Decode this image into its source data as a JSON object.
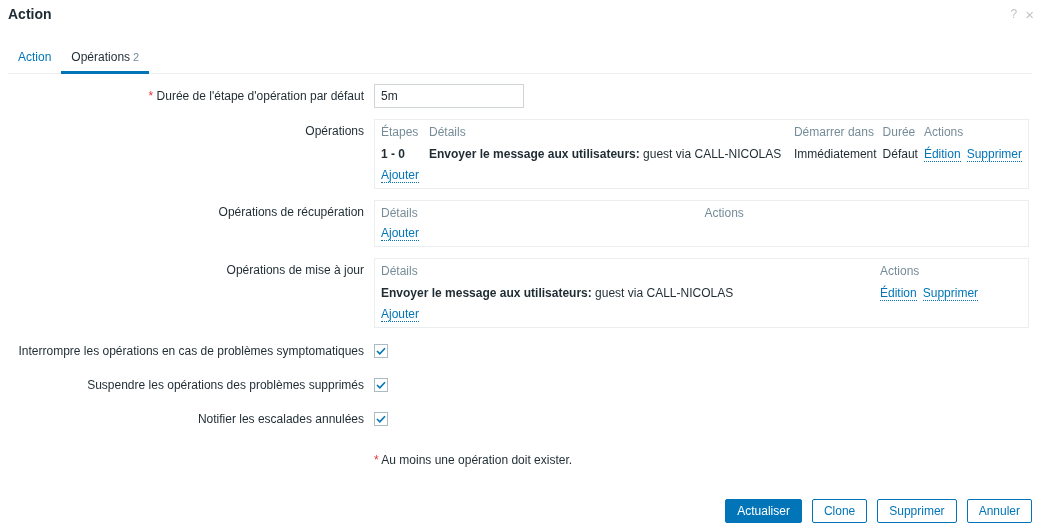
{
  "dialog": {
    "title": "Action",
    "help": "?",
    "close": "×"
  },
  "tabs": [
    {
      "label": "Action",
      "selected": false
    },
    {
      "label": "Opérations",
      "count": "2",
      "selected": true
    }
  ],
  "duration": {
    "label": "Durée de l'étape d'opération par défaut",
    "required": true,
    "value": "5m"
  },
  "tables": [
    {
      "label": "Opérations",
      "columns": [
        "Étapes",
        "Détails",
        "Démarrer dans",
        "Durée",
        "Actions"
      ],
      "rows": [
        {
          "cells": [
            "**1 - 0**",
            "**Envoyer le message aux utilisateurs:** guest via CALL-NICOLAS",
            "Immédiatement",
            "Défaut"
          ],
          "actions": [
            "Édition",
            "Supprimer"
          ]
        }
      ],
      "add_link": "Ajouter"
    },
    {
      "label": "Opérations de récupération",
      "columns": [
        "Détails",
        "Actions"
      ],
      "add_link": "Ajouter"
    },
    {
      "label": "Opérations de mise à jour",
      "columns": [
        "Détails",
        "Actions"
      ],
      "rows": [
        {
          "cells": [
            "**Envoyer le message aux utilisateurs:** guest via CALL-NICOLAS"
          ],
          "actions": [
            "Édition",
            "Supprimer"
          ]
        }
      ],
      "add_link": "Ajouter"
    }
  ],
  "options": [
    {
      "label": "Interrompre les opérations en cas de problèmes symptomatiques",
      "checked": true
    },
    {
      "label": "Suspendre les opérations des problèmes supprimés",
      "checked": true
    },
    {
      "label": "Notifier les escalades annulées",
      "checked": true
    }
  ],
  "note": {
    "mark": "*",
    "text": "Au moins une opération doit exister."
  },
  "buttons": [
    {
      "label": "Actualiser",
      "kind": "primary"
    },
    {
      "label": "Clone",
      "kind": "secondary"
    },
    {
      "label": "Supprimer",
      "kind": "secondary"
    },
    {
      "label": "Annuler",
      "kind": "secondary"
    }
  ]
}
